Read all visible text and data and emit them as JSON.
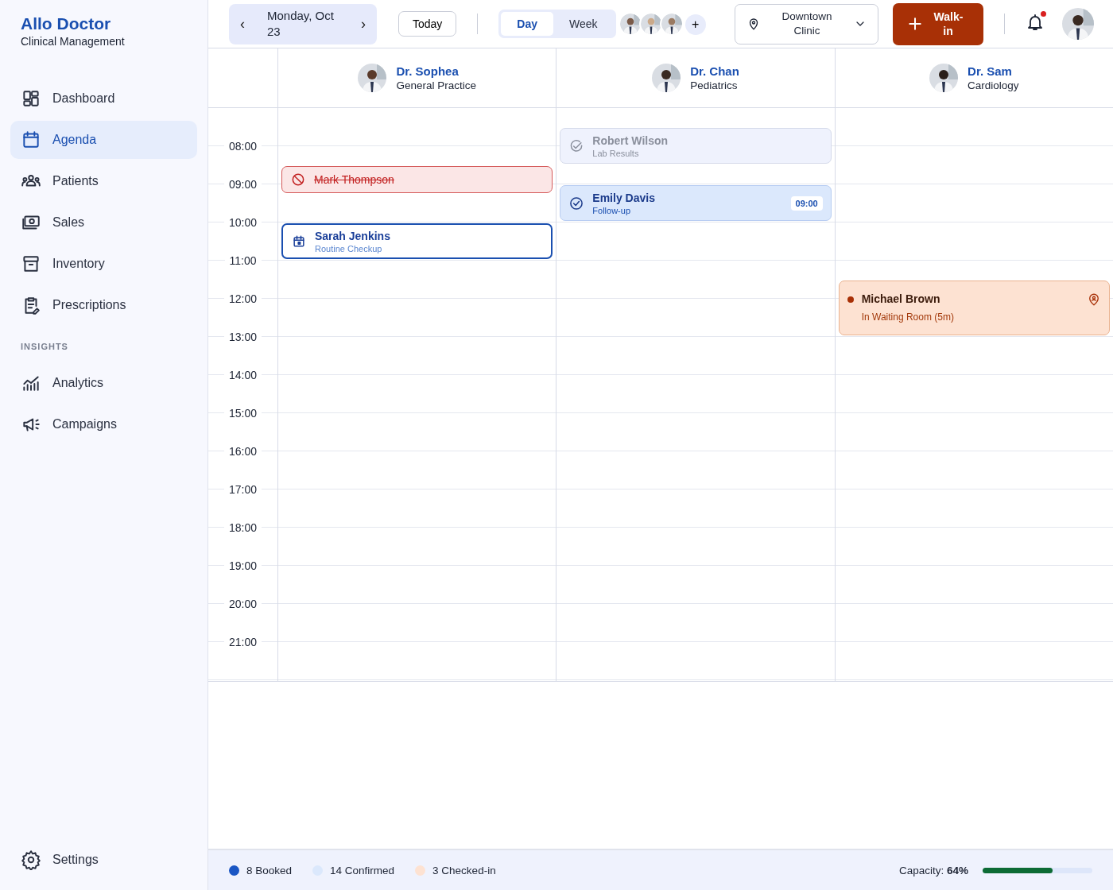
{
  "brand": {
    "title": "Allo Doctor",
    "subtitle": "Clinical Management"
  },
  "sidebar": {
    "items": [
      {
        "label": "Dashboard",
        "selected": false
      },
      {
        "label": "Agenda",
        "selected": true
      },
      {
        "label": "Patients",
        "selected": false
      },
      {
        "label": "Sales",
        "selected": false
      },
      {
        "label": "Inventory",
        "selected": false
      },
      {
        "label": "Prescriptions",
        "selected": false
      }
    ],
    "section": "INSIGHTS",
    "insights": [
      {
        "label": "Analytics",
        "selected": false
      },
      {
        "label": "Campaigns",
        "selected": false
      }
    ],
    "footer": {
      "label": "Settings",
      "selected": false
    }
  },
  "toolbar": {
    "date": "Monday, Oct 23",
    "prev": "‹",
    "next": "›",
    "today": "Today",
    "views": [
      {
        "label": "Day",
        "selected": true
      },
      {
        "label": "Week",
        "selected": false
      }
    ],
    "add_staff": "+",
    "location": "Downtown Clinic",
    "walk_in": "Walk-in",
    "notifications": true
  },
  "doctors": [
    {
      "name": "Dr. Sophea",
      "specialty": "General Practice",
      "appointments": [
        {
          "patient": "Mark Thompson",
          "kind": "cancelled"
        },
        {
          "patient": "Sarah Jenkins",
          "detail": "Routine Checkup",
          "kind": "booked"
        }
      ]
    },
    {
      "name": "Dr. Chan",
      "specialty": "Pediatrics",
      "appointments": [
        {
          "patient": "Robert Wilson",
          "detail": "Lab Results",
          "kind": "completed"
        },
        {
          "patient": "Emily Davis",
          "detail": "Follow-up",
          "time": "09:00",
          "kind": "confirmed"
        }
      ]
    },
    {
      "name": "Dr. Sam",
      "specialty": "Cardiology",
      "appointments": [
        {
          "patient": "Michael Brown",
          "detail": "In Waiting Room (5m)",
          "kind": "waiting"
        }
      ]
    }
  ],
  "times": [
    "08:00",
    "09:00",
    "10:00",
    "11:00",
    "12:00",
    "13:00",
    "14:00",
    "15:00",
    "16:00",
    "17:00",
    "18:00",
    "19:00",
    "20:00",
    "21:00"
  ],
  "legend": [
    {
      "label": "8 Booked",
      "color": "#1a56c4"
    },
    {
      "label": "14 Confirmed",
      "color": "#dbe8fc"
    },
    {
      "label": "3 Checked-in",
      "color": "#fde2d2"
    }
  ],
  "capacity": {
    "label": "Capacity:",
    "value": "64%",
    "level": 0.64
  }
}
